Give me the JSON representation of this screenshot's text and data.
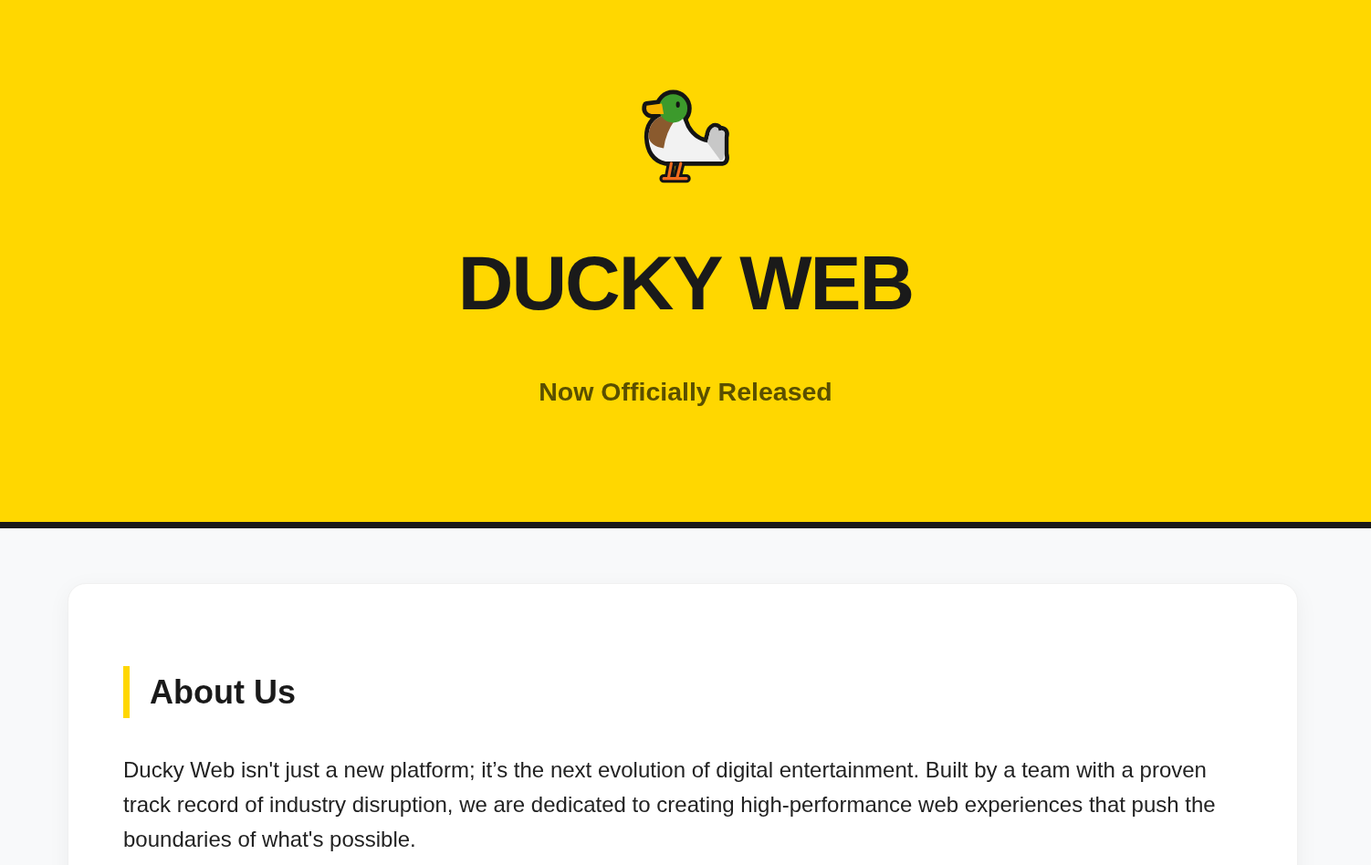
{
  "hero": {
    "title": "DUCKY WEB",
    "subtitle": "Now Officially Released"
  },
  "sections": [
    {
      "heading": "About Us",
      "text": "Ducky Web isn't just a new platform; it’s the next evolution of digital entertainment. Built by a team with a proven track record of industry disruption, we are dedicated to creating high-performance web experiences that push the boundaries of what's possible."
    }
  ]
}
